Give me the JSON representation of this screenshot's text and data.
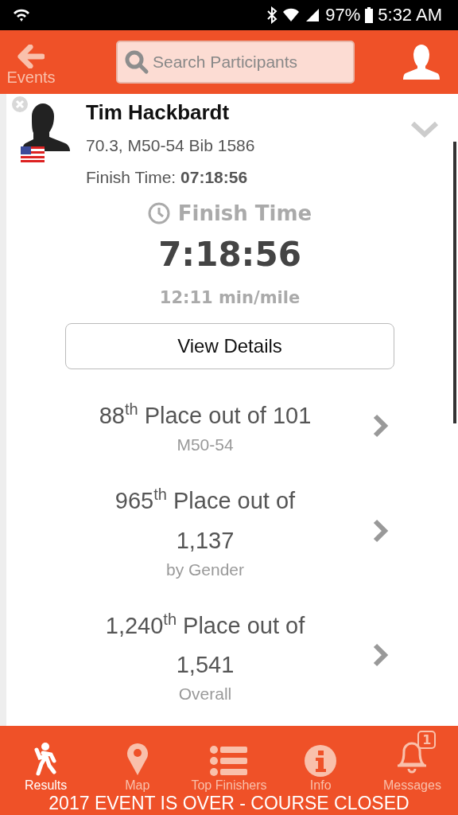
{
  "status_bar": {
    "battery": "97%",
    "time": "5:32 AM"
  },
  "header": {
    "back_label": "Events",
    "search": {
      "placeholder": "Search Participants"
    }
  },
  "athlete": {
    "name": "Tim Hackbardt",
    "details": "70.3, M50-54 Bib 1586",
    "finish_label": "Finish Time:",
    "finish_value": "07:18:56"
  },
  "finish": {
    "title": "Finish Time",
    "time": "7:18:56",
    "pace": "12:11 min/mile",
    "button": "View Details"
  },
  "places": [
    {
      "text": "88$^{th}$ Place out of 101",
      "category": "M50-54"
    },
    {
      "text": "965$^{th}$ Place out of 1,137",
      "category": "by Gender"
    },
    {
      "text": "1,240$^{th}$ Place out of 1,541",
      "category": "Overall"
    }
  ],
  "tabs": [
    {
      "kind": "results",
      "label": "Results",
      "selected": true
    },
    {
      "kind": "map",
      "label": "Map",
      "selected": false
    },
    {
      "kind": "list",
      "label": "Top Finishers",
      "selected": false
    },
    {
      "kind": "info",
      "label": "Info",
      "selected": false
    },
    {
      "kind": "messages",
      "label": "Messages",
      "selected": false,
      "badge": "1"
    }
  ],
  "banner": "2017 EVENT IS OVER - COURSE CLOSED"
}
